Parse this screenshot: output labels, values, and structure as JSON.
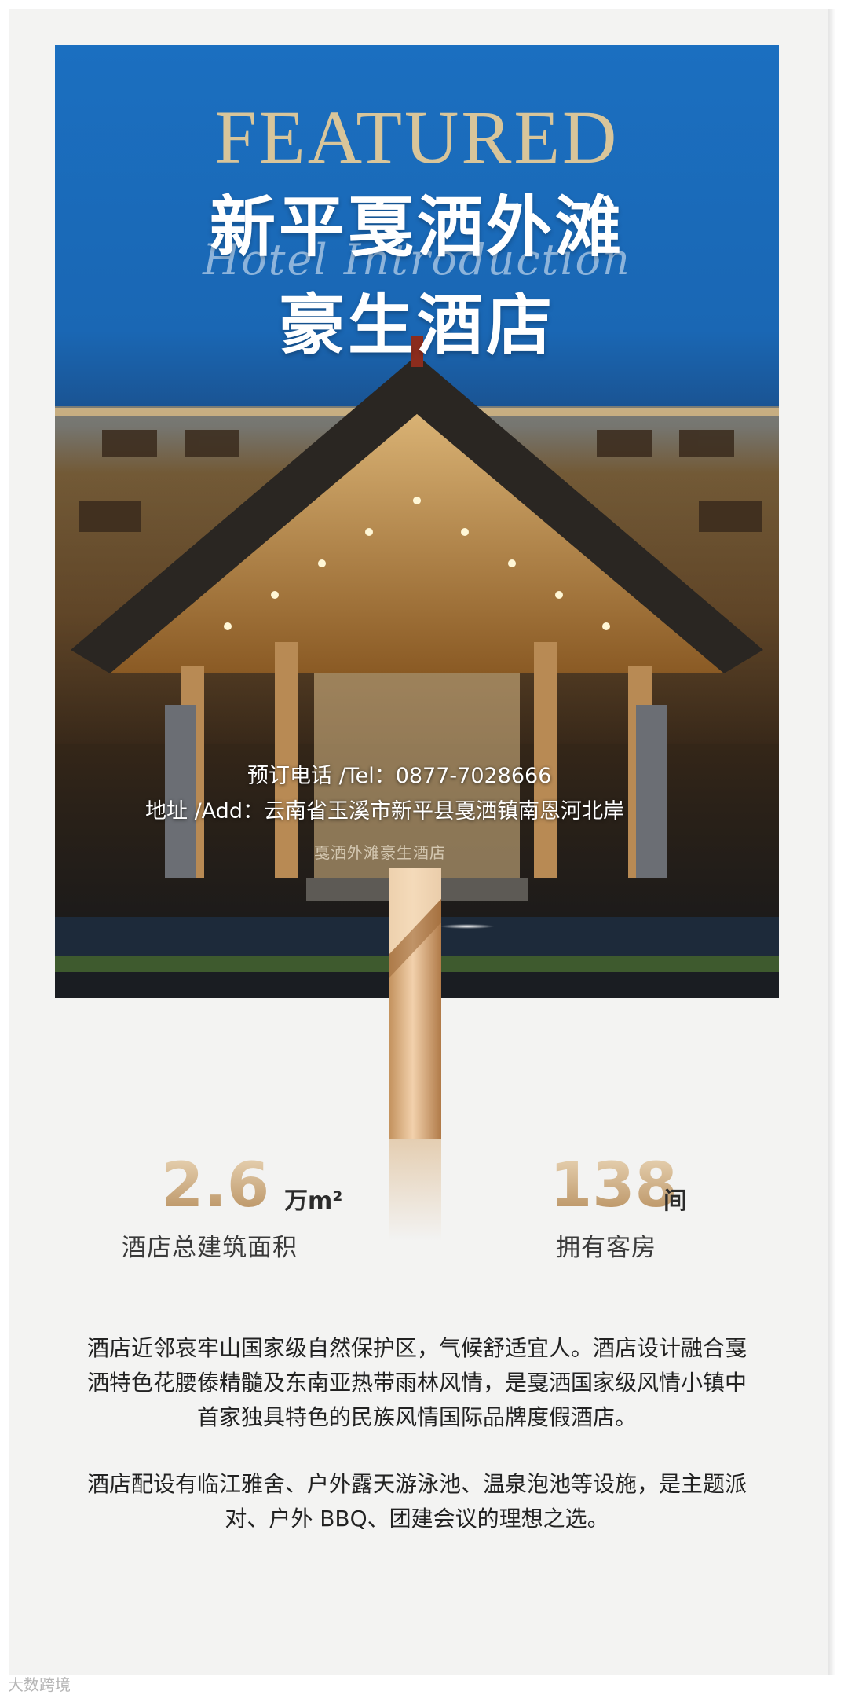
{
  "hero": {
    "featured": "FEATURED",
    "title_line1": "新平戛洒外滩",
    "title_line2": "豪生酒店",
    "script_text": "Hotel Introduction",
    "tel": "预订电话 /Tel：0877-7028666",
    "address": "地址 /Add：云南省玉溪市新平县戛洒镇南恩河北岸",
    "sign": "戛洒外滩豪生酒店"
  },
  "stats": [
    {
      "value": "2.6",
      "unit": "万m²",
      "label": "酒店总建筑面积"
    },
    {
      "value": "138",
      "unit": "间",
      "label": "拥有客房"
    }
  ],
  "description": {
    "p1_lines": [
      "酒店近邻哀牢山国家级自然保护区，气候舒适宜人。酒店设计融合戛",
      "洒特色花腰傣精髓及东南亚热带雨林风情，是戛洒国家级风情小镇中",
      "首家独具特色的民族风情国际品牌度假酒店。"
    ],
    "p2_lines": [
      "酒店配设有临江雅舍、户外露天游泳池、温泉泡池等设施，是主题派",
      "对、户外 BBQ、团建会议的理想之选。"
    ]
  },
  "watermark": "大数跨境",
  "colors": {
    "sky": "#1b6fc0",
    "gold": "#c9a06c",
    "background": "#f3f3f2"
  }
}
